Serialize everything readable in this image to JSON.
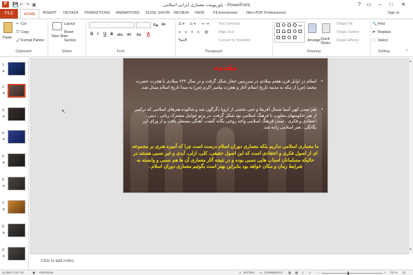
{
  "window": {
    "title": "پاورپوینت معماری ایرانی اسلامی - PowerPoint",
    "app_icon": "P",
    "sign_in": "Sign in",
    "controls": [
      "?",
      "▭",
      "–",
      "□",
      "✕"
    ]
  },
  "tabs": [
    "FILE",
    "HOME",
    "INSERT",
    "DESIGN",
    "TRANSITIONS",
    "ANIMATIONS",
    "SLIDE SHOW",
    "REVIEW",
    "VIEW",
    "FILEminimizer",
    "Nitro PDF Professional"
  ],
  "ribbon": {
    "clipboard": {
      "paste": "Paste",
      "cut": "Cut",
      "copy": "Copy",
      "format_painter": "Format Painter",
      "label": "Clipboard"
    },
    "slides": {
      "new_slide": "New Slide",
      "layout": "Layout",
      "reset": "Reset",
      "section": "Section",
      "label": "Slides"
    },
    "font": {
      "label": "Font",
      "bold": "B",
      "italic": "I",
      "underline": "U",
      "strike": "S",
      "shadow": "abc",
      "spacing": "AV",
      "case": "Aa",
      "font_color": "A"
    },
    "paragraph": {
      "text_direction": "Text Direction",
      "align_text": "Align Text",
      "convert_smartart": "Convert to SmartArt",
      "label": "Paragraph"
    },
    "drawing": {
      "arrange": "Arrange",
      "quick_styles": "Quick Styles",
      "shape_fill": "Shape Fill",
      "shape_outline": "Shape Outline",
      "shape_effects": "Shape Effects",
      "label": "Drawing"
    },
    "editing": {
      "find": "Find",
      "replace": "Replace",
      "select": "Select",
      "label": "Editing"
    }
  },
  "thumbnails": [
    {
      "num": "1",
      "star": "★"
    },
    {
      "num": "2",
      "star": "★"
    },
    {
      "num": "3",
      "star": "★"
    },
    {
      "num": "4",
      "star": "★"
    },
    {
      "num": "5",
      "star": "★"
    },
    {
      "num": "6",
      "star": "★"
    },
    {
      "num": "7",
      "star": "★"
    },
    {
      "num": "8",
      "star": "★"
    },
    {
      "num": "9",
      "star": "★"
    }
  ],
  "slide": {
    "title": "مقدمه",
    "bullet1": "اسلام در اوایل قرن هفتم میلادی در سرزمین حجاز شکل گرفت و در سال ۶۲۲ میلادی با هجرت حضرت محمد (ص) از مکه به مدینه تاریخ اسلام آغاز و هجرت پیامبر اکرم (ص) به مبدا تاریخ اسلام مبدل شد.",
    "bullet2": "هنر تمدن کهن آسیا شمال آفریقا و حتی بخشی از اروپا دگرگون شد و شالوده هنرهای اسلامی که ترکیبی از هنر حکومتهای مغلوب با فرهنگ اسلامی بود شکل گرفت. در پرتو عوامل مشترک زبانی ، دینی ، اعتقادی و فکری ، تمدن فرهنگ اسلامی واجد روحی یگانه گشت. آهنگی مستقل یافت و از ورای این یگانگی ، هنر اسلامی زاده شد.",
    "yellow": "ما معماری اسلامی نداریم بلکه معماری دوران اسلام درست است چرا که آمیزه هنری بر مجموعه ای از اصول فکری و اعتقادی است که این اصول حقیقی، کلی، ازلی، آبدی و غیر نسبی هستند در حالیکه مسلمانان اسباب هایی نسبی بوده و در نتیجه آثار معماری آن ها هم نسبی و وابسته به شرایط زمان و مکان خواهد بود بنابراین بهتر است بگوئیم معماری دوران اسلام ."
  },
  "notes": {
    "placeholder": "Click to add notes"
  },
  "status": {
    "slide": "SLIDE 2 OF 24",
    "language": "PERSIAN",
    "notes": "NOTES",
    "comments": "COMMENTS",
    "zoom": "70 %"
  }
}
